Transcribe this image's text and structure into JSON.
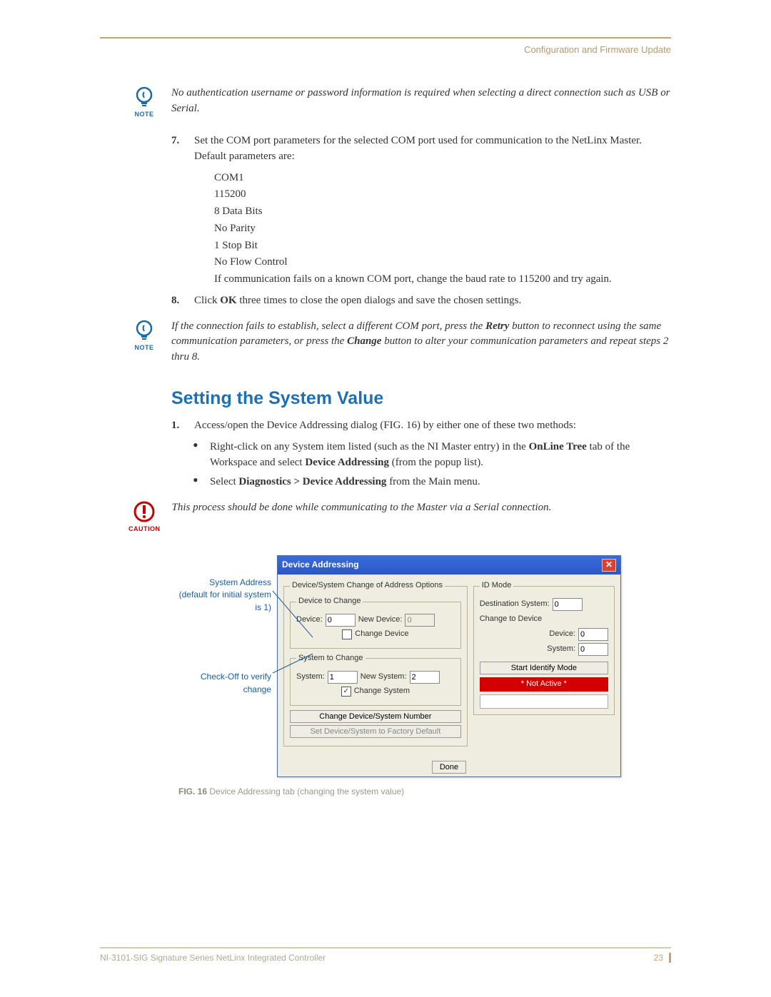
{
  "header": {
    "right": "Configuration and Firmware Update"
  },
  "note1": {
    "label": "NOTE",
    "text": "No authentication username or password information is required when selecting a direct connection such as USB or Serial."
  },
  "step7": {
    "num": "7.",
    "text_a": "Set the COM port parameters for the selected COM port used for communication to the NetLinx Master. Default parameters are:",
    "params": [
      "COM1",
      "115200",
      "8 Data Bits",
      "No Parity",
      "1 Stop Bit",
      "No Flow Control"
    ],
    "text_b": "If communication fails on a known COM port, change the baud rate to 115200 and try again."
  },
  "step8": {
    "num": "8.",
    "prefix": "Click ",
    "bold": "OK",
    "suffix": " three times to close the open dialogs and save the chosen settings."
  },
  "note2": {
    "label": "NOTE",
    "line1_a": "If the connection fails to establish, select a different COM port, press the ",
    "line1_b": "Retry",
    "line1_c": " button to reconnect using the same communication parameters, or press the ",
    "line1_d": "Change",
    "line1_e": " button to alter your communication parameters and repeat steps 2 thru 8."
  },
  "section_title": "Setting the System Value",
  "step1": {
    "num": "1.",
    "text": "Access/open the Device Addressing dialog (FIG. 16) by either one of these two methods:"
  },
  "bullets": {
    "b1_a": "Right-click on any System item listed (such as the NI Master entry) in the ",
    "b1_b": "OnLine Tree",
    "b1_c": " tab of the Workspace and select ",
    "b1_d": "Device Addressing",
    "b1_e": " (from the popup list).",
    "b2_a": "Select ",
    "b2_b": "Diagnostics > Device Addressing",
    "b2_c": " from the Main menu."
  },
  "caution": {
    "label": "CAUTION",
    "text": "This process should be done while communicating to the Master via a Serial connection."
  },
  "fig_labels": {
    "l1": "System Address (default for initial system is 1)",
    "l2": "Check-Off to verify change"
  },
  "dialog": {
    "title": "Device Addressing",
    "group1": "Device/System Change of Address Options",
    "group1a": "Device to Change",
    "device_lbl": "Device:",
    "device_val": "0",
    "newdevice_lbl": "New Device:",
    "newdevice_val": "0",
    "change_device_btn": "Change Device",
    "group1b": "System to Change",
    "system_lbl": "System:",
    "system_val": "1",
    "newsystem_lbl": "New System:",
    "newsystem_val": "2",
    "change_system_chk": "Change System",
    "btn_change": "Change Device/System Number",
    "btn_factory": "Set Device/System to Factory Default",
    "group2": "ID Mode",
    "dest_lbl": "Destination System:",
    "dest_val": "0",
    "ctd": "Change to Device",
    "dev2_lbl": "Device:",
    "dev2_val": "0",
    "sys2_lbl": "System:",
    "sys2_val": "0",
    "btn_start": "Start Identify Mode",
    "status": "* Not Active *",
    "done": "Done"
  },
  "caption": {
    "bold": "FIG. 16",
    "text": "  Device Addressing tab (changing the system value)"
  },
  "footer": {
    "left": "NI-3101-SIG Signature Series NetLinx Integrated Controller",
    "page": "23"
  }
}
